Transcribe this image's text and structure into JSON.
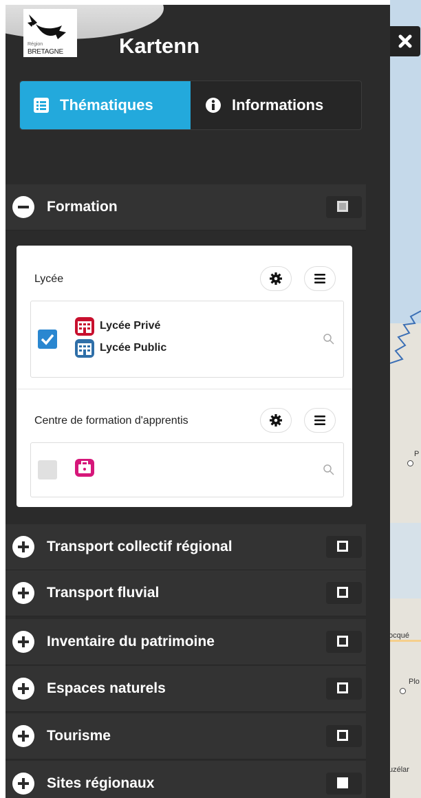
{
  "app": {
    "title": "Kartenn",
    "logo_lines": [
      "Région",
      "BRETAGNE"
    ]
  },
  "tabs": [
    {
      "label": "Thématiques",
      "icon": "list-icon",
      "active": true
    },
    {
      "label": "Informations",
      "icon": "info-icon",
      "active": false
    }
  ],
  "categories": [
    {
      "label": "Formation",
      "expanded": true,
      "checkbox": "partial"
    },
    {
      "label": "Transport collectif régional",
      "expanded": false,
      "checkbox": "unchecked"
    },
    {
      "label": "Transport fluvial",
      "expanded": false,
      "checkbox": "unchecked"
    },
    {
      "label": "Inventaire du patrimoine",
      "expanded": false,
      "checkbox": "unchecked"
    },
    {
      "label": "Espaces naturels",
      "expanded": false,
      "checkbox": "unchecked"
    },
    {
      "label": "Tourisme",
      "expanded": false,
      "checkbox": "unchecked"
    },
    {
      "label": "Sites régionaux",
      "expanded": false,
      "checkbox": "checked-white"
    }
  ],
  "formation_layers": [
    {
      "title": "Lycée",
      "checked": true,
      "legend": [
        {
          "label": "Lycée Privé",
          "color": "#c8102e"
        },
        {
          "label": "Lycée Public",
          "color": "#2f6fa8"
        }
      ]
    },
    {
      "title": "Centre de formation d'apprentis",
      "checked": false,
      "legend": [
        {
          "label": "",
          "color": "#d6177a"
        }
      ]
    }
  ],
  "map_labels": [
    "P",
    "ocqué",
    "Plo",
    "uzélar"
  ],
  "colors": {
    "panel_bg": "#2b2b2b",
    "category_bg": "#333333",
    "accent": "#23a9dc",
    "checkbox_on": "#2a87d0"
  }
}
